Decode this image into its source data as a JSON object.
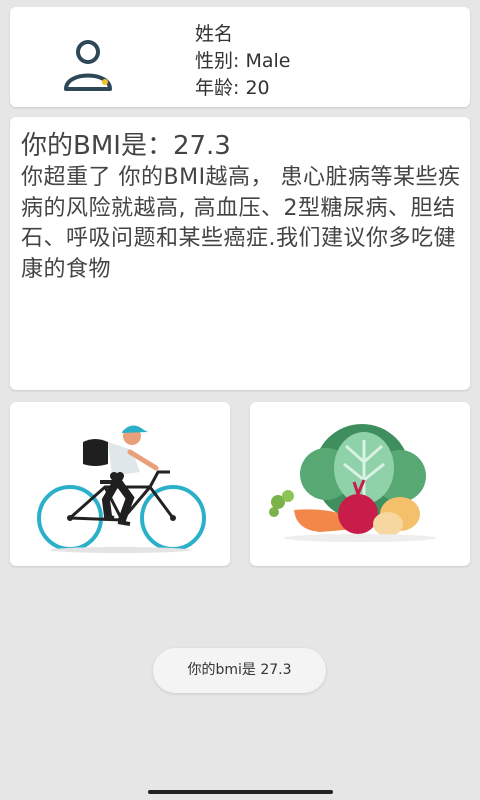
{
  "profile": {
    "name_label": "姓名",
    "gender_line": "性别: Male",
    "age_line": "年龄: 20",
    "avatar_icon": "person-icon"
  },
  "bmi": {
    "title": "你的BMI是：27.3",
    "advice": "你超重了 你的BMI越高， 患心脏病等某些疾病的风险就越高, 高血压、2型糖尿病、胆结石、呼吸问题和某些癌症.我们建议你多吃健康的食物"
  },
  "tiles": [
    {
      "icon": "cyclist-illustration"
    },
    {
      "icon": "vegetables-illustration"
    }
  ],
  "toast": {
    "text": "你的bmi是   27.3"
  },
  "colors": {
    "background": "#e6e6e6",
    "card": "#ffffff",
    "avatar_stroke": "#2f4858",
    "avatar_accent": "#f2c12e"
  }
}
